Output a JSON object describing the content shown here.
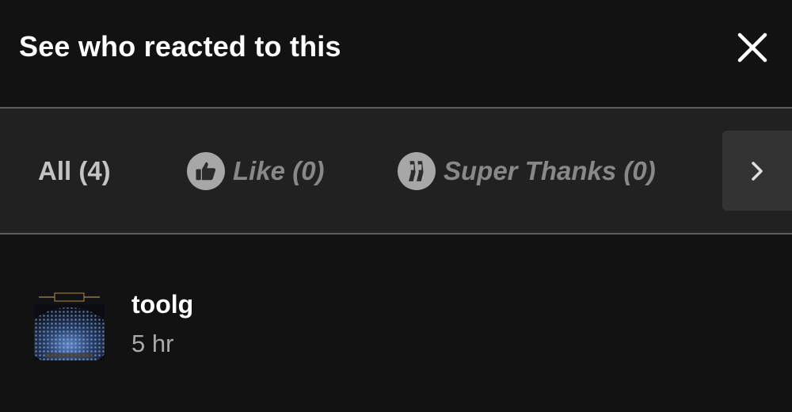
{
  "header": {
    "title": "See who reacted to this",
    "close_icon": "close-icon"
  },
  "tabs": [
    {
      "label": "All (4)",
      "icon": null,
      "selected": true
    },
    {
      "label": "Like (0)",
      "icon": "thumbs-up-icon",
      "selected": false
    },
    {
      "label": "Super Thanks (0)",
      "icon": "super-thanks-icon",
      "selected": false
    }
  ],
  "next_icon": "chevron-right-icon",
  "reactions": [
    {
      "name": "toolg",
      "time": "5 hr",
      "avatar": "album-art-avatar"
    }
  ],
  "colors": {
    "background": "#121212",
    "tab_bar": "#212121",
    "divider": "#5e5e5e",
    "tab_selected": "#c4c4c4",
    "tab_inactive": "#888888"
  }
}
